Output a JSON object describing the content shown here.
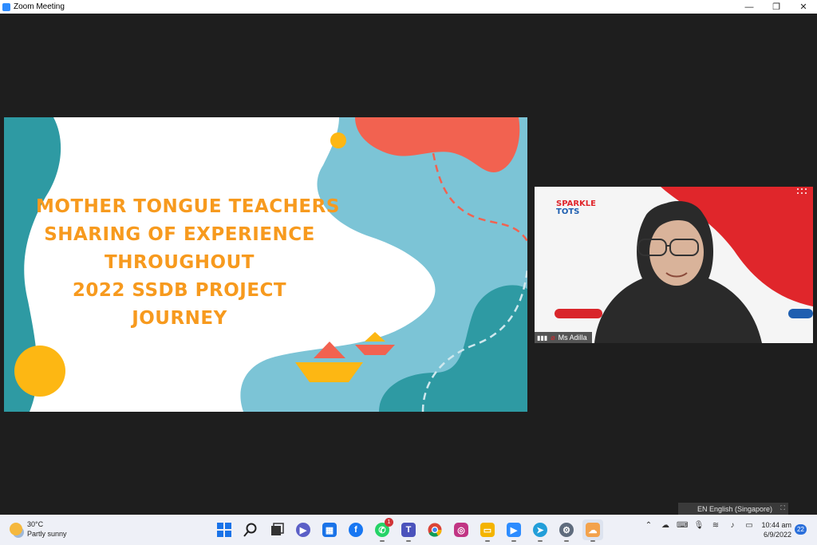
{
  "window": {
    "title": "Zoom Meeting",
    "minimize": "—",
    "restore": "❐",
    "close": "✕"
  },
  "slide": {
    "title_lines": [
      "MOTHER TONGUE TEACHERS",
      "SHARING OF EXPERIENCE",
      "THROUGHOUT",
      "2022 SSDB PROJECT",
      "JOURNEY"
    ],
    "colors": {
      "teal": "#2e9aa3",
      "light_blue": "#7cc4d6",
      "coral": "#f26250",
      "yellow": "#fdb713",
      "title": "#f79a1e"
    }
  },
  "participant": {
    "name": "Ms Adilla",
    "logo_top": "SPARKLE",
    "logo_bottom": "TOTS"
  },
  "language_bar": {
    "label": "EN English (Singapore)"
  },
  "taskbar": {
    "weather": {
      "temp": "30°C",
      "condition": "Partly sunny"
    },
    "apps": [
      {
        "name": "windows-start",
        "color": "#1a73e8"
      },
      {
        "name": "search",
        "color": "#222222"
      },
      {
        "name": "task-view",
        "color": "#333333"
      },
      {
        "name": "teams-chat",
        "color": "#5b5fc7"
      },
      {
        "name": "calendar",
        "color": "#1a73e8"
      },
      {
        "name": "facebook",
        "color": "#1877f2"
      },
      {
        "name": "whatsapp",
        "color": "#25d366",
        "badge": "1"
      },
      {
        "name": "teams",
        "color": "#4b53bc"
      },
      {
        "name": "chrome",
        "color": "#db4437"
      },
      {
        "name": "instagram",
        "color": "#c13584"
      },
      {
        "name": "file-explorer",
        "color": "#f4b400"
      },
      {
        "name": "zoom",
        "color": "#2d8cff"
      },
      {
        "name": "telegram",
        "color": "#229ed9"
      },
      {
        "name": "settings",
        "color": "#5e6b7d"
      },
      {
        "name": "onedrive",
        "color": "#f3a24c"
      }
    ],
    "clock": {
      "time": "10:44 am",
      "date": "6/9/2022"
    },
    "notifications": "22"
  }
}
